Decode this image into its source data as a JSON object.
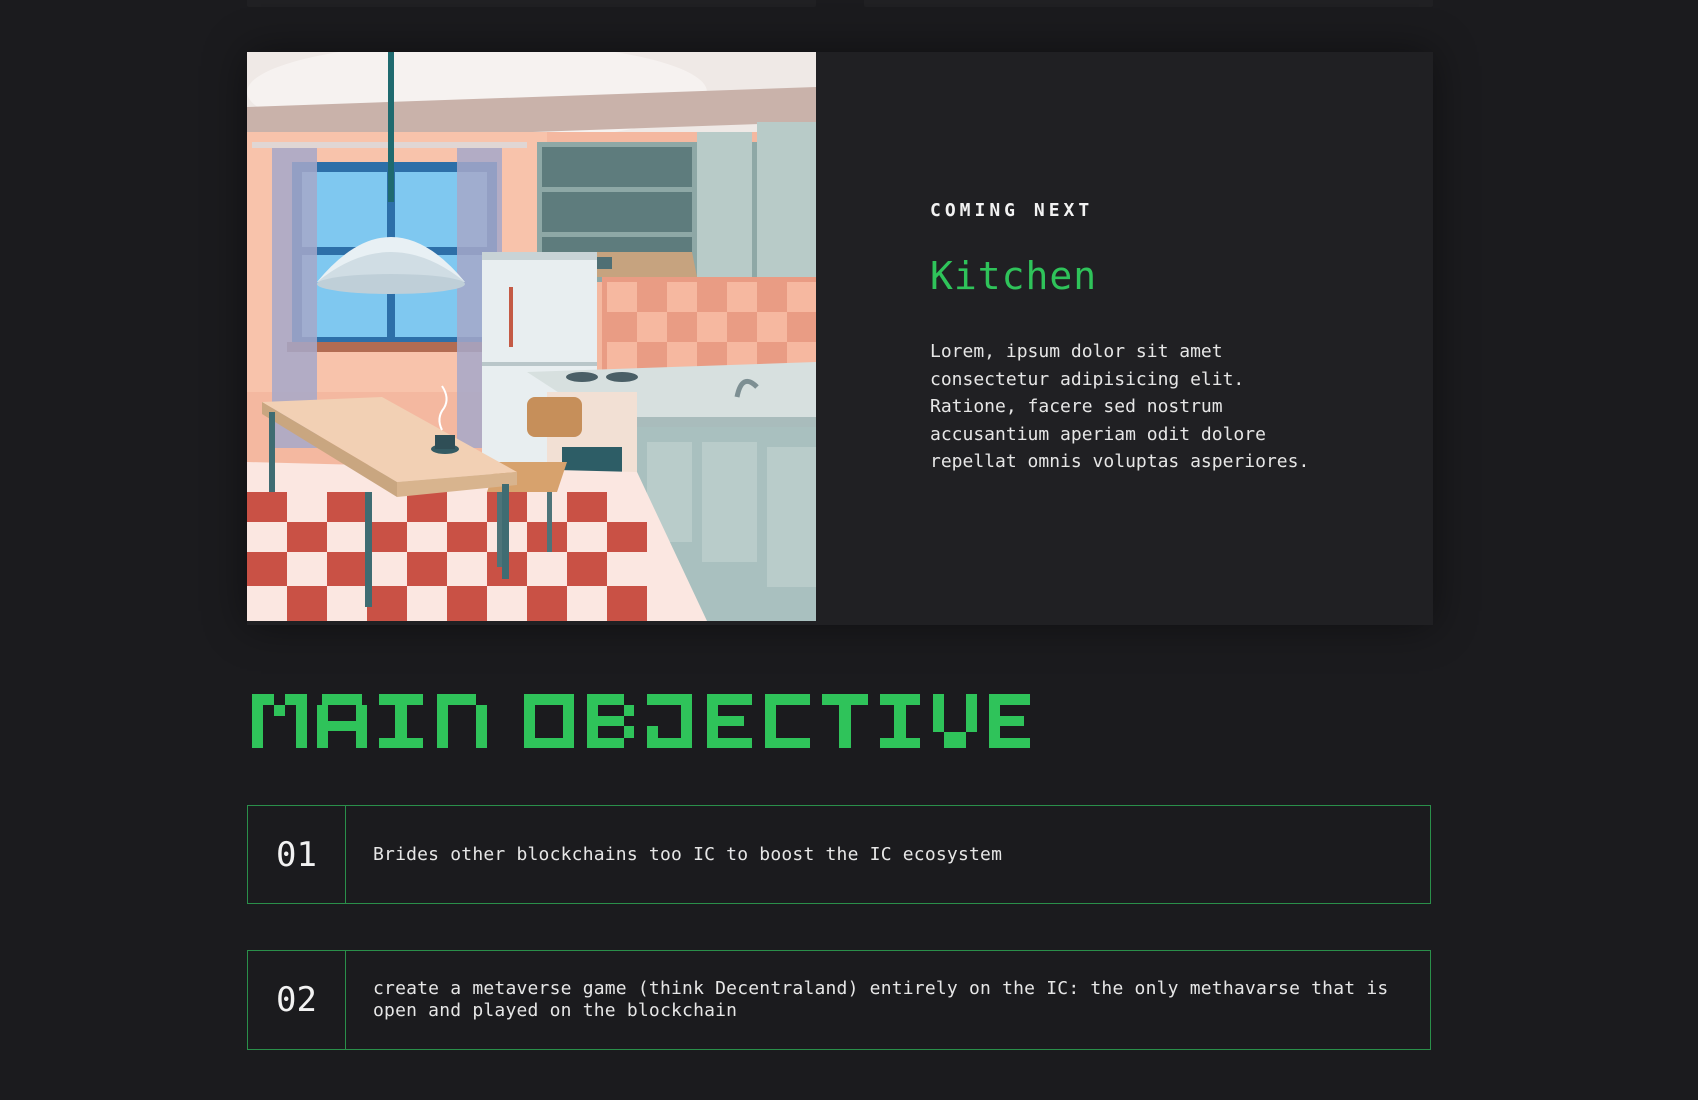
{
  "feature": {
    "eyebrow": "COMING NEXT",
    "title": "Kitchen",
    "description": "Lorem, ipsum dolor sit amet consectetur adipisicing elit. Ratione, facere sed nostrum accusantium aperiam odit dolore repellat omnis voluptas asperiores.",
    "image_icon": "kitchen-illustration"
  },
  "objectives": {
    "title": "MAIN OBJECTIVES",
    "items": [
      {
        "number": "01",
        "text": "Brides other blockchains too IC to boost the IC ecosystem"
      },
      {
        "number": "02",
        "text": "create a metaverse game (think Decentraland) entirely on the IC: the only methavarse that is open and played on the blockchain"
      }
    ]
  },
  "colors": {
    "background": "#1b1b1e",
    "card": "#202023",
    "accent_green": "#2fc35a",
    "border_green": "#2a8f4a",
    "text": "#e6e6e6"
  }
}
